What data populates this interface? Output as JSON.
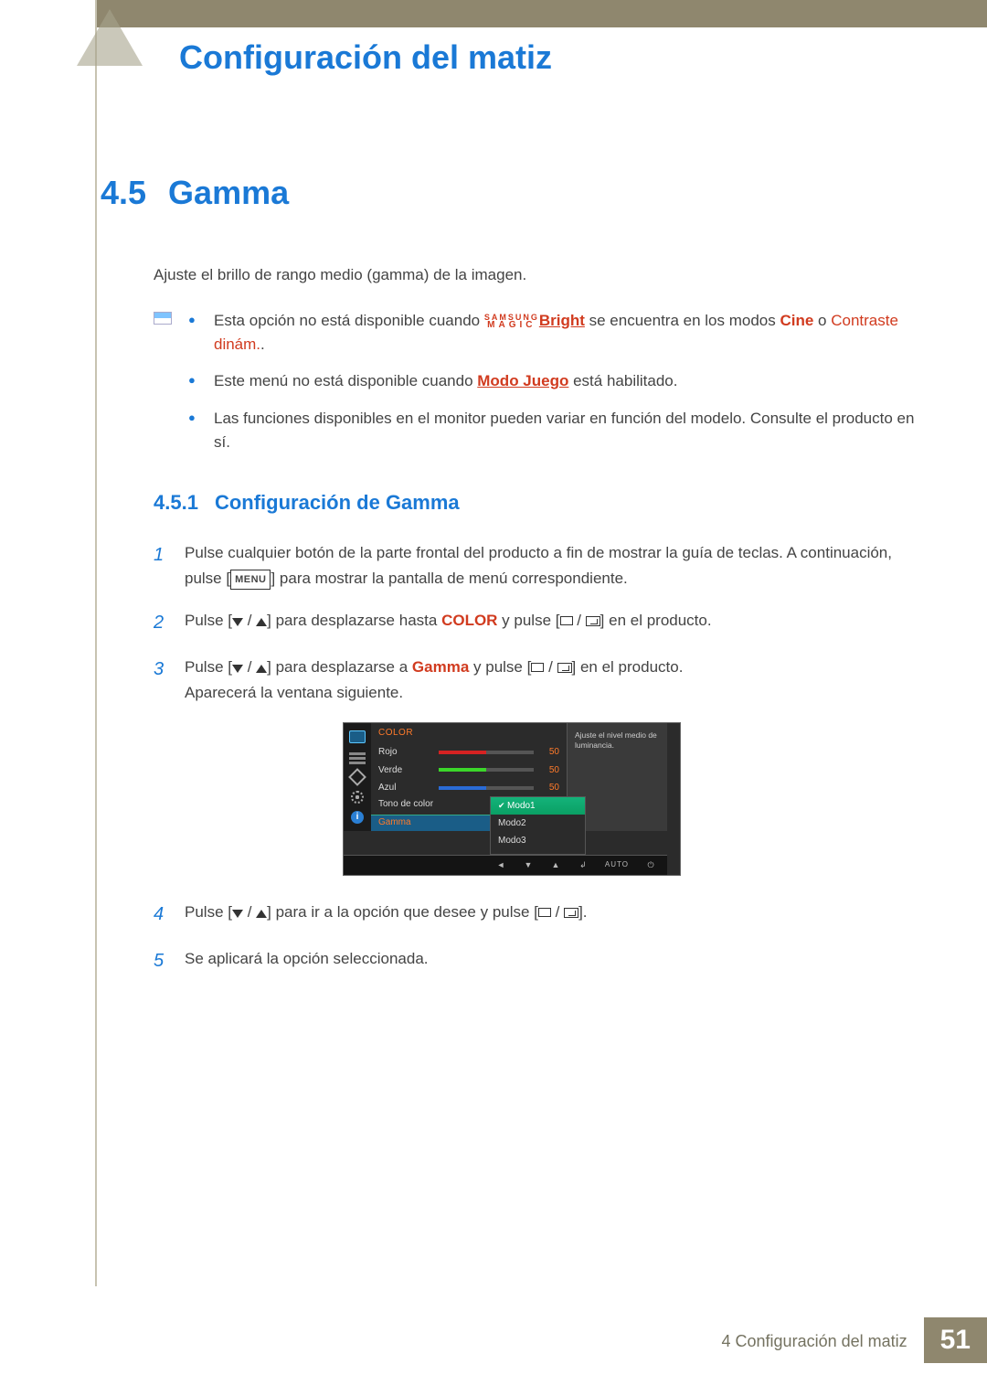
{
  "chapter_title": "Configuración del matiz",
  "section": {
    "num": "4.5",
    "title": "Gamma"
  },
  "intro": "Ajuste el brillo de rango medio (gamma) de la imagen.",
  "notes": {
    "n1_a": "Esta opción no está disponible cuando ",
    "magic_top": "SAMSUNG",
    "magic_bot": "MAGIC",
    "magic_bright": "Bright",
    "n1_b": " se encuentra en los modos ",
    "cine": "Cine",
    "n1_c": " o ",
    "contraste": "Contraste dinám.",
    "n1_d": ".",
    "n2_a": "Este menú no está disponible cuando ",
    "modo_juego": "Modo Juego",
    "n2_b": " está habilitado.",
    "n3": "Las funciones disponibles en el monitor pueden variar en función del modelo. Consulte el producto en sí."
  },
  "subsection": {
    "num": "4.5.1",
    "title": "Configuración de Gamma"
  },
  "steps": {
    "s1_a": "Pulse cualquier botón de la parte frontal del producto a fin de mostrar la guía de teclas. A continuación, pulse [",
    "menu_badge": "MENU",
    "s1_b": "] para mostrar la pantalla de menú correspondiente.",
    "s2_a": "Pulse [",
    "s2_b": "] para desplazarse hasta ",
    "color": "COLOR",
    "s2_c": " y pulse [",
    "s2_d": "] en el producto.",
    "s3_a": "Pulse [",
    "s3_b": "] para desplazarse a ",
    "gamma": "Gamma",
    "s3_c": " y pulse [",
    "s3_d": "] en el producto.",
    "s3_e": "Aparecerá la ventana siguiente.",
    "s4_a": "Pulse [",
    "s4_b": "] para ir a la opción que desee y pulse [",
    "s4_c": "].",
    "s5": "Se aplicará la opción seleccionada."
  },
  "osd": {
    "header": "COLOR",
    "tip": "Ajuste el nivel medio de luminancia.",
    "rows": {
      "rojo": "Rojo",
      "verde": "Verde",
      "azul": "Azul",
      "tono": "Tono de color",
      "gamma": "Gamma"
    },
    "vals": {
      "rojo": "50",
      "verde": "50",
      "azul": "50"
    },
    "modes": {
      "m1": "Modo1",
      "m2": "Modo2",
      "m3": "Modo3"
    },
    "auto": "AUTO",
    "info_i": "i"
  },
  "footer": {
    "label": "4 Configuración del matiz",
    "page": "51"
  }
}
